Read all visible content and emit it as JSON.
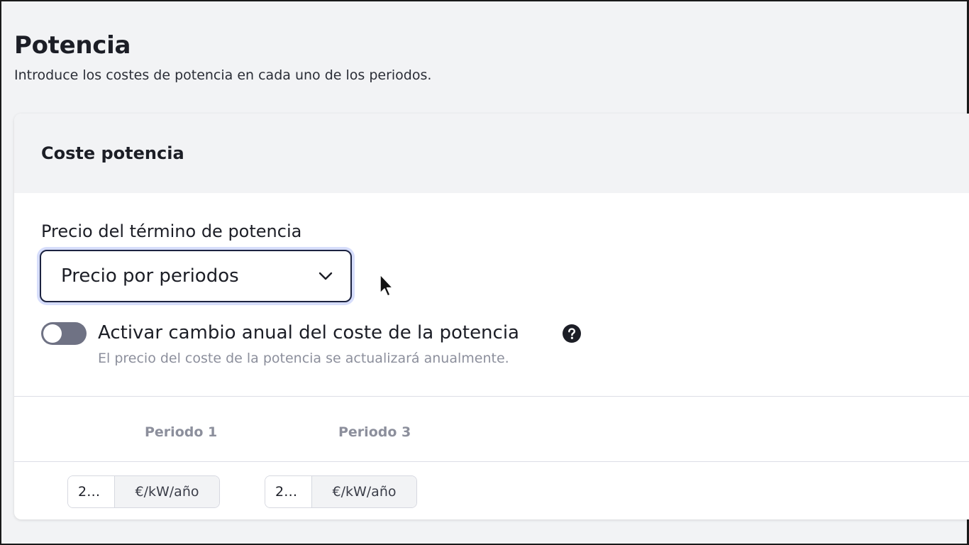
{
  "page": {
    "title": "Potencia",
    "subtitle": "Introduce los costes de potencia en cada uno de los periodos."
  },
  "card": {
    "title": "Coste potencia",
    "price_field": {
      "label": "Precio del término de potencia",
      "selected_value": "Precio por periodos"
    },
    "annual_toggle": {
      "label": "Activar cambio anual del coste de la potencia",
      "hint": "El precio del coste de la potencia se actualizará anualmente.",
      "enabled": false
    },
    "periods": [
      {
        "header": "Periodo 1",
        "value": "2…",
        "unit": "€/kW/año"
      },
      {
        "header": "Periodo 3",
        "value": "2…",
        "unit": "€/kW/año"
      }
    ]
  },
  "colors": {
    "select_border": "#1c2340",
    "select_focus_ring": "#d6ddfb",
    "toggle_off": "#6f7284",
    "muted_text": "#8c8f9c",
    "header_bg": "#f2f3f5"
  },
  "icons": {
    "select_chevron": "chevron-down-icon",
    "help": "question-circle-icon",
    "pointer": "mouse-cursor-icon"
  }
}
